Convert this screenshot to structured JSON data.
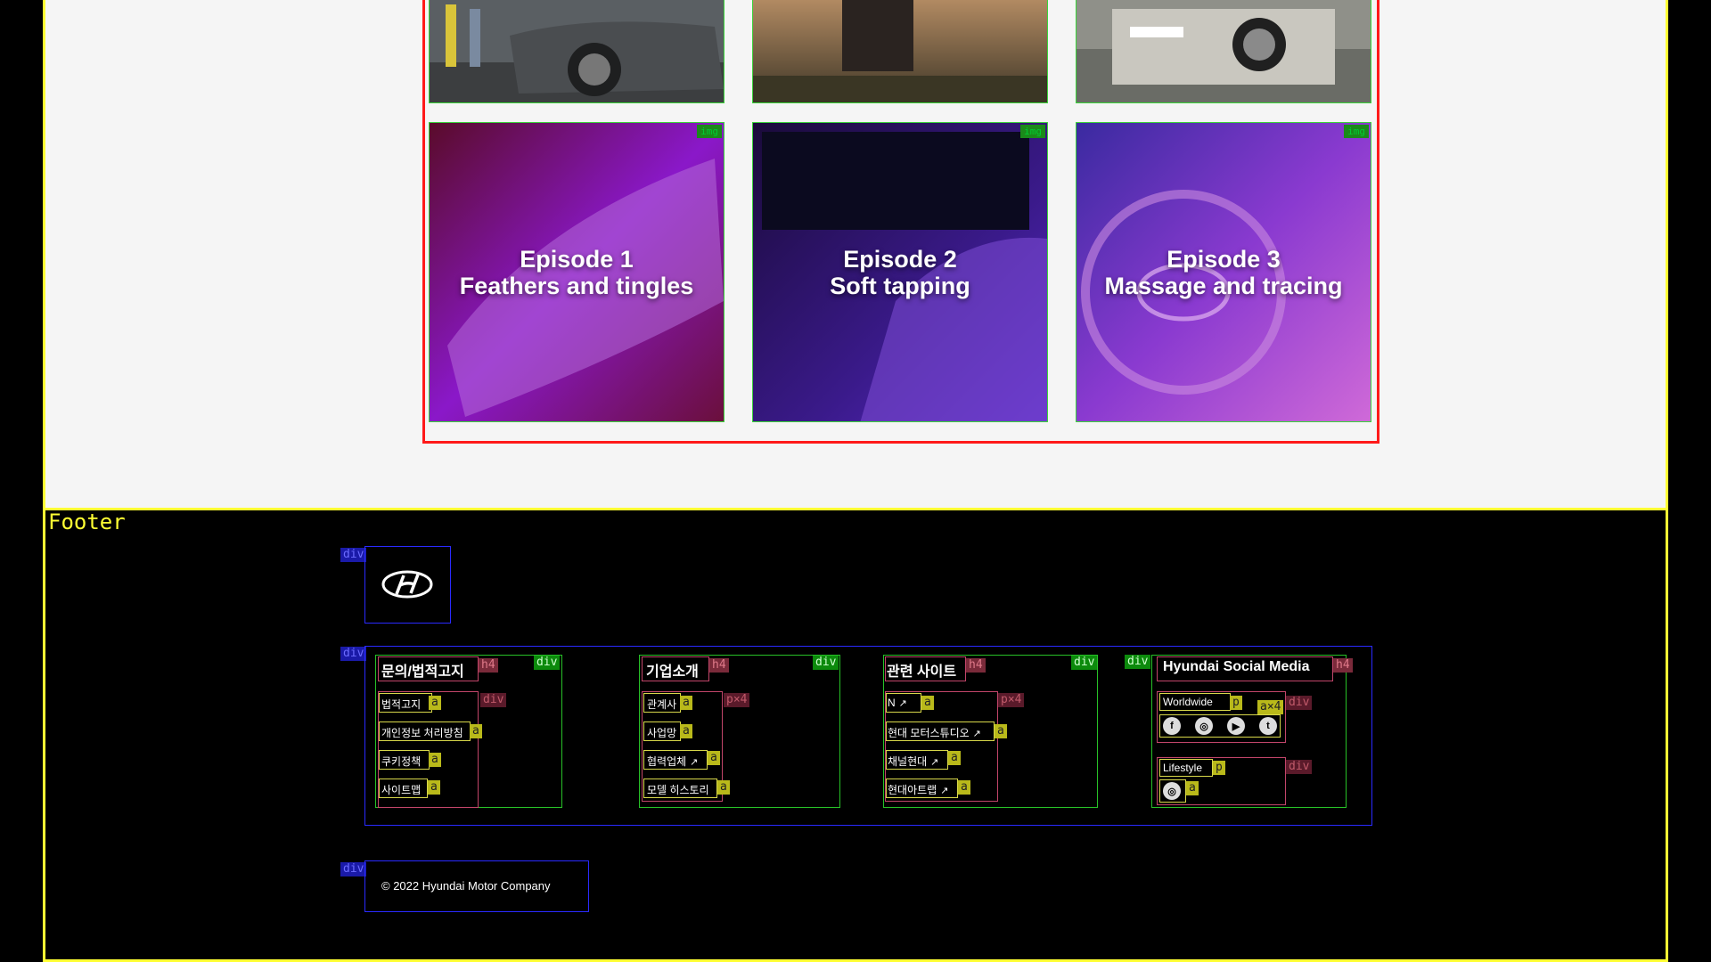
{
  "episodes": [
    {
      "line1": "Episode 1",
      "line2": "Feathers and tingles"
    },
    {
      "line1": "Episode 2",
      "line2": "Soft tapping"
    },
    {
      "line1": "Episode 3",
      "line2": "Massage and tracing"
    }
  ],
  "tag_img": "img",
  "footer_label": "Footer",
  "tags": {
    "div": "div",
    "h4": "h4",
    "a": "a",
    "p": "p",
    "px4": "p×4",
    "a4": "a×4"
  },
  "columns": {
    "notice": {
      "title": "문의/법적고지",
      "links": [
        "법적고지",
        "개인정보 처리방침",
        "쿠키정책",
        "사이트맵"
      ]
    },
    "company": {
      "title": "기업소개",
      "links": [
        "관계사",
        "사업망",
        "협력업체",
        "모델 히스토리"
      ]
    },
    "related": {
      "title": "관련 사이트",
      "links": [
        "N",
        "현대 모터스튜디오",
        "채널현대",
        "현대아트랩"
      ]
    },
    "social": {
      "title": "Hyundai Social Media",
      "worldwide": "Worldwide",
      "lifestyle": "Lifestyle"
    }
  },
  "social_icons": [
    "facebook-icon",
    "instagram-icon",
    "youtube-icon",
    "twitter-icon"
  ],
  "copyright": "© 2022 Hyundai Motor Company"
}
